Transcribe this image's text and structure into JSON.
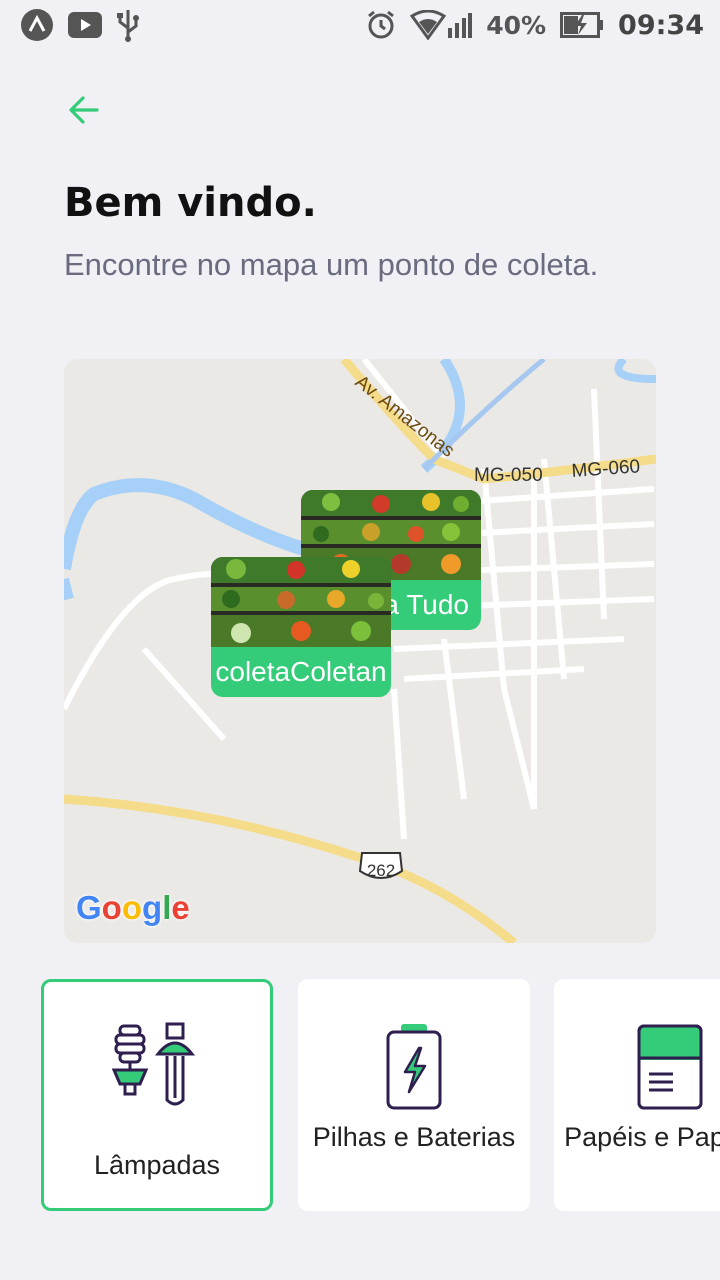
{
  "status_bar": {
    "icons_left": [
      "app-logo-icon",
      "youtube-icon",
      "usb-icon"
    ],
    "icons_right": [
      "alarm-icon",
      "wifi-icon",
      "signal-icon",
      "battery-charging-icon"
    ],
    "battery": "40%",
    "time": "09:34"
  },
  "header": {
    "back_icon": "arrow-left-icon",
    "title": "Bem vindo.",
    "subtitle": "Encontre no mapa um ponto de coleta."
  },
  "map": {
    "road_labels": [
      "Av. Amazonas",
      "MG-050",
      "MG-060",
      "262"
    ],
    "markers": [
      {
        "label": "a Tudo"
      },
      {
        "label": "coletaColetan"
      }
    ],
    "attribution": "Google"
  },
  "items": [
    {
      "label": "Lâmpadas",
      "icon": "lamp-icon",
      "selected": true
    },
    {
      "label": "Pilhas e Baterias",
      "icon": "battery-icon",
      "selected": false
    },
    {
      "label": "Papéis e Papelão",
      "icon": "paper-icon",
      "selected": false
    }
  ],
  "colors": {
    "accent": "#34cb79",
    "background": "#f0f0f5",
    "title": "#111111",
    "subtitle": "#6b6b80"
  }
}
